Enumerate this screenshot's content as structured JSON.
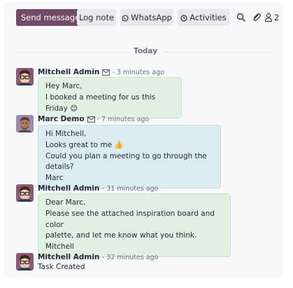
{
  "toolbar": {
    "send_message": "Send message",
    "log_note": "Log note",
    "whatsapp": "WhatsApp",
    "activities": "Activities",
    "followers_count": "2"
  },
  "separator": {
    "label": "Today"
  },
  "messages": [
    {
      "author": "Mitchell Admin",
      "time": "- 3 minutes ago",
      "lines": [
        "Hey Marc,",
        "I booked a meeting for us this Friday 😊"
      ]
    },
    {
      "author": "Marc Demo",
      "time": "- 7 minutes ago",
      "lines": [
        "Hi Mitchell,",
        "Looks great to me 👍",
        "Could you plan a meeting to go through the details?",
        "Marc"
      ]
    },
    {
      "author": "Mitchell Admin",
      "time": "- 31 minutes ago",
      "lines": [
        "Dear Marc,",
        "Please see the attached inspiration board and color",
        "palette, and let me know what you think.",
        "Mitchell"
      ]
    },
    {
      "author": "Mitchell Admin",
      "time": "- 32 minutes ago",
      "text": "Task Created"
    }
  ]
}
